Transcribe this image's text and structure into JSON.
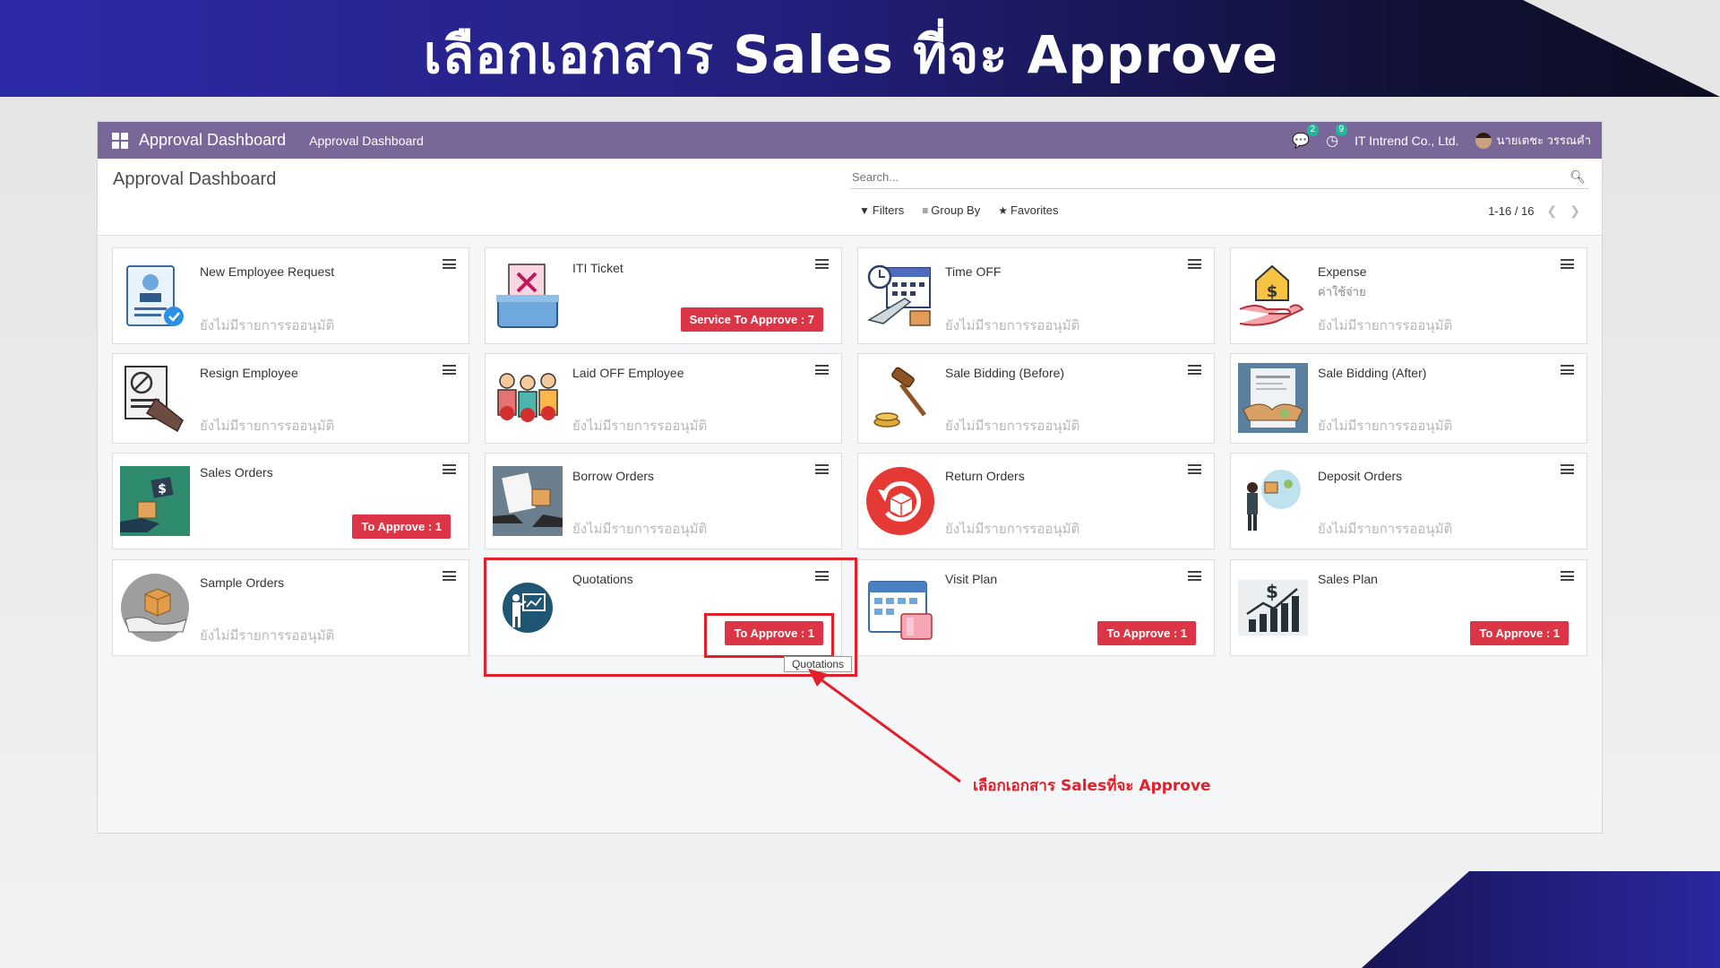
{
  "banner": {
    "title": "เลือกเอกสาร Sales ที่จะ Approve"
  },
  "navbar": {
    "brand": "Approval Dashboard",
    "menu_link": "Approval Dashboard",
    "messages_count": "2",
    "activities_count": "9",
    "company": "IT Intrend Co., Ltd.",
    "user": "นายเตชะ วรรณคำ"
  },
  "control": {
    "title": "Approval Dashboard",
    "search_placeholder": "Search...",
    "filters": "Filters",
    "group_by": "Group By",
    "favorites": "Favorites",
    "pager": "1-16 / 16"
  },
  "cards": [
    {
      "title": "New Employee Request",
      "empty": "ยังไม่มีรายการรออนุมัติ",
      "icon": "employee-request-icon"
    },
    {
      "title": "ITI Ticket",
      "button": "Service To Approve : 7",
      "icon": "ticket-icon"
    },
    {
      "title": "Time OFF",
      "empty": "ยังไม่มีรายการรออนุมัติ",
      "icon": "time-off-icon"
    },
    {
      "title": "Expense",
      "subtitle": "ค่าใช้จ่าย",
      "empty": "ยังไม่มีรายการรออนุมัติ",
      "icon": "expense-icon"
    },
    {
      "title": "Resign Employee",
      "empty": "ยังไม่มีรายการรออนุมัติ",
      "icon": "resign-icon"
    },
    {
      "title": "Laid OFF Employee",
      "empty": "ยังไม่มีรายการรออนุมัติ",
      "icon": "laid-off-icon"
    },
    {
      "title": "Sale Bidding (Before)",
      "empty": "ยังไม่มีรายการรออนุมัติ",
      "icon": "gavel-icon"
    },
    {
      "title": "Sale Bidding (After)",
      "empty": "ยังไม่มีรายการรออนุมัติ",
      "icon": "contract-icon"
    },
    {
      "title": "Sales Orders",
      "button": "To Approve : 1",
      "icon": "sales-orders-icon"
    },
    {
      "title": "Borrow Orders",
      "empty": "ยังไม่มีรายการรออนุมัติ",
      "icon": "borrow-icon"
    },
    {
      "title": "Return Orders",
      "empty": "ยังไม่มีรายการรออนุมัติ",
      "icon": "return-icon"
    },
    {
      "title": "Deposit Orders",
      "empty": "ยังไม่มีรายการรออนุมัติ",
      "icon": "deposit-icon"
    },
    {
      "title": "Sample Orders",
      "empty": "ยังไม่มีรายการรออนุมัติ",
      "icon": "sample-icon"
    },
    {
      "title": "Quotations",
      "button": "To Approve : 1",
      "icon": "presentation-icon"
    },
    {
      "title": "Visit Plan",
      "button": "To Approve : 1",
      "icon": "calendar-icon"
    },
    {
      "title": "Sales Plan",
      "button": "To Approve : 1",
      "icon": "chart-growth-icon"
    }
  ],
  "tooltip": "Quotations",
  "annotation": "เลือกเอกสาร Salesที่จะ Approve",
  "colors": {
    "navbar": "#7a6799",
    "button": "#dc3545",
    "highlight": "#e0202a"
  }
}
